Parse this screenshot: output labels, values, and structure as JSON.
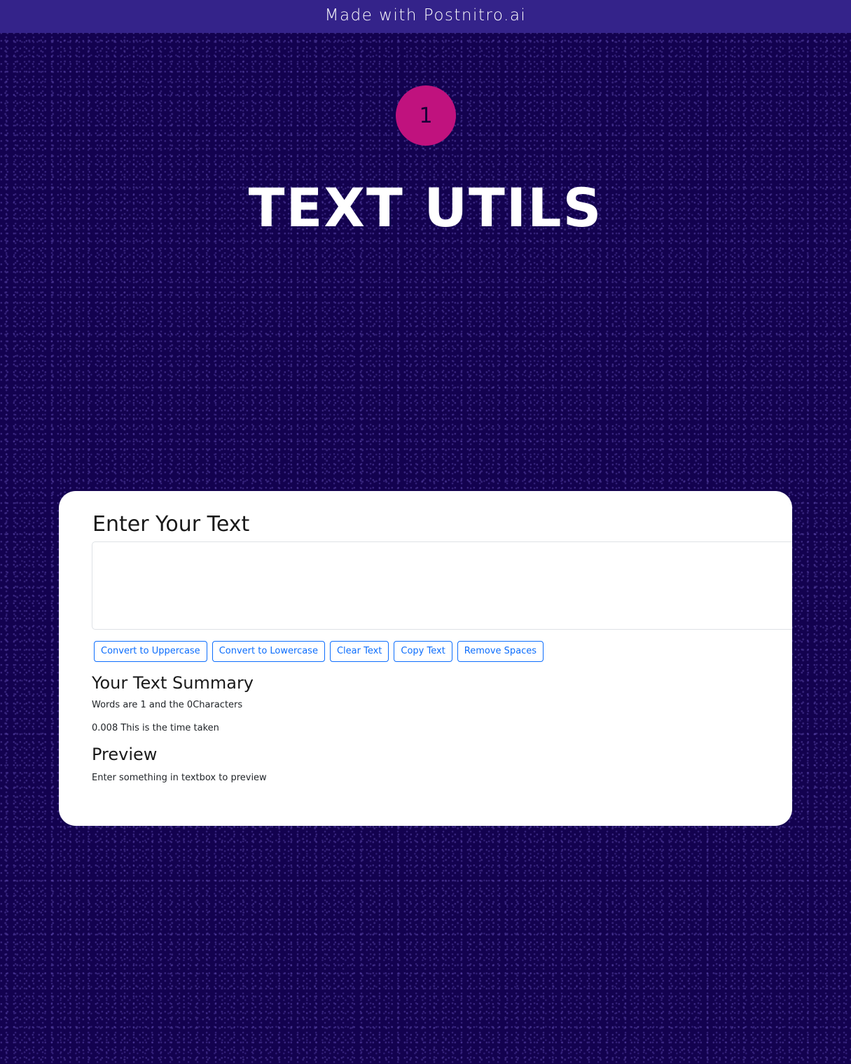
{
  "banner": {
    "text": "Made with Postnitro.ai"
  },
  "slide": {
    "step_number": "1",
    "title": "TEXT UTILS"
  },
  "app": {
    "heading": "Enter Your Text",
    "textarea": {
      "value": "",
      "placeholder": ""
    },
    "buttons": {
      "uppercase": "Convert to Uppercase",
      "lowercase": "Convert to Lowercase",
      "clear": "Clear Text",
      "copy": "Copy Text",
      "remove_spaces": "Remove Spaces"
    },
    "summary": {
      "heading": "Your Text Summary",
      "words_line": "Words are 1 and the 0Characters",
      "time_line": "0.008 This is the time taken"
    },
    "preview": {
      "heading": "Preview",
      "text": "Enter something in textbox to preview"
    }
  },
  "colors": {
    "background": "#13024f",
    "banner": "#34238a",
    "badge": "#c0127e",
    "button_accent": "#0d6efd"
  }
}
